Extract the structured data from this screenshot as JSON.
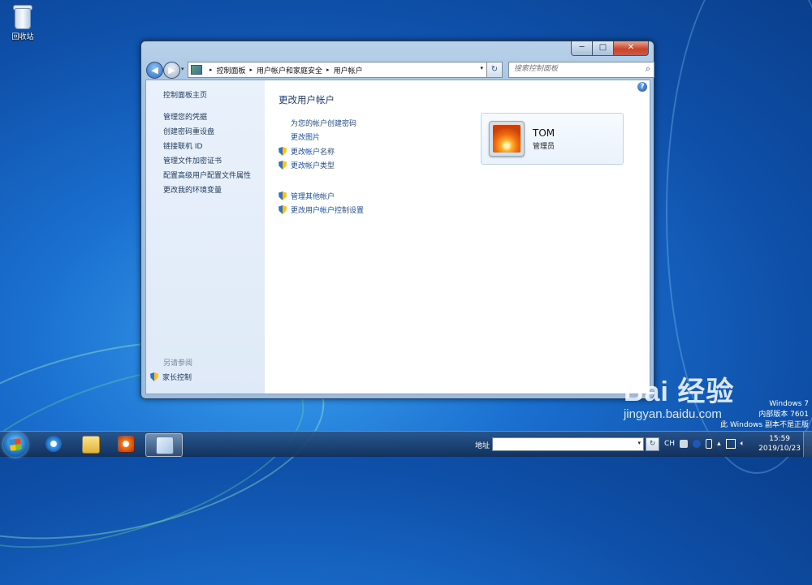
{
  "desktop": {
    "recycle_bin_label": "回收站",
    "windows_info": [
      "Windows 7",
      "内部版本 7601",
      "此 Windows 副本不是正版"
    ],
    "watermark": {
      "main": "Bai 经验",
      "sub": "jingyan.baidu.com"
    }
  },
  "window": {
    "controls": {
      "minimize": "─",
      "maximize": "□",
      "close": "✕"
    },
    "breadcrumb": [
      "控制面板",
      "用户帐户和家庭安全",
      "用户帐户"
    ],
    "breadcrumb_separator": "▸",
    "search_placeholder": "搜索控制面板",
    "help_label": "?"
  },
  "sidebar": {
    "home": "控制面板主页",
    "items": [
      "管理您的凭据",
      "创建密码重设盘",
      "链接联机 ID",
      "管理文件加密证书",
      "配置高级用户配置文件属性",
      "更改我的环境变量"
    ],
    "see_also_label": "另请参阅",
    "see_also_items": [
      "家长控制"
    ]
  },
  "main": {
    "title": "更改用户帐户",
    "links": [
      {
        "label": "为您的帐户创建密码",
        "shield": false
      },
      {
        "label": "更改图片",
        "shield": false
      },
      {
        "label": "更改帐户名称",
        "shield": true
      },
      {
        "label": "更改帐户类型",
        "shield": true
      }
    ],
    "links2": [
      {
        "label": "管理其他帐户",
        "shield": true
      },
      {
        "label": "更改用户帐户控制设置",
        "shield": true
      }
    ]
  },
  "user_card": {
    "name": "TOM",
    "role": "管理员"
  },
  "taskbar": {
    "address_label": "地址",
    "address_value": "",
    "tray_lang": "CH",
    "clock_time": "15:59",
    "clock_date": "2019/10/23"
  }
}
